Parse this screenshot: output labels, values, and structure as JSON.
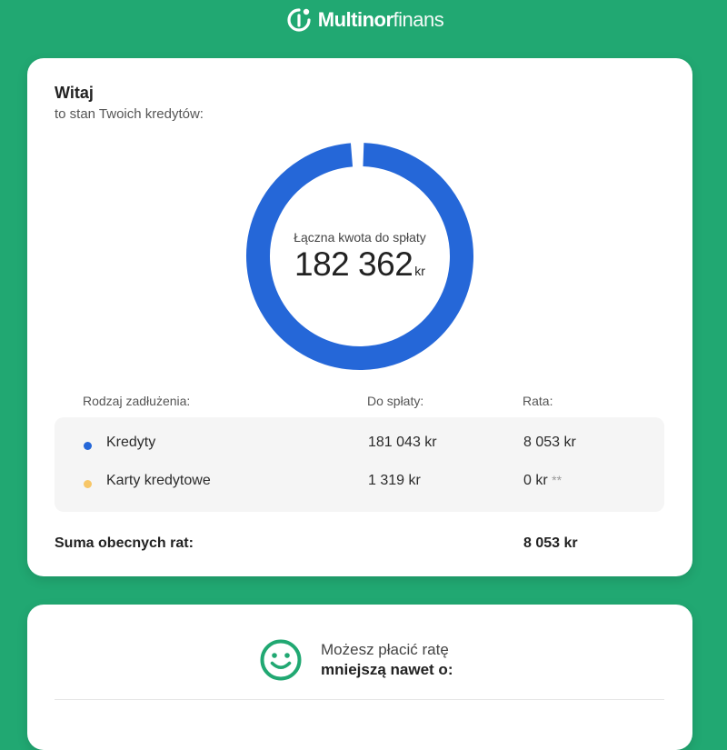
{
  "brand": {
    "name_bold": "Multinor",
    "name_light": "finans"
  },
  "summary": {
    "greeting": "Witaj",
    "subtitle": "to stan Twoich kredytów:",
    "total_label": "Łączna kwota do spłaty",
    "total_value": "182 362",
    "total_unit": "kr"
  },
  "table": {
    "headers": {
      "type": "Rodzaj zadłużenia:",
      "due": "Do spłaty:",
      "rate": "Rata:"
    },
    "rows": [
      {
        "name": "Kredyty",
        "due": "181 043 kr",
        "rate": "8 053 kr",
        "note": ""
      },
      {
        "name": "Karty kredytowe",
        "due": "1 319 kr",
        "rate": "0 kr",
        "note": "**"
      }
    ],
    "sum_label": "Suma obecnych rat:",
    "sum_value": "8 053 kr"
  },
  "payment": {
    "line1": "Możesz płacić ratę",
    "line2": "mniejszą nawet o:"
  },
  "chart_data": {
    "type": "pie",
    "categories": [
      "Kredyty",
      "Karty kredytowe"
    ],
    "values": [
      181043,
      1319
    ]
  },
  "colors": {
    "background": "#21a872",
    "credits": "#2567d8",
    "cards": "#f7c667",
    "smiley": "#21a872",
    "logo": "#ffffff"
  },
  "icons": {
    "logo": "multinor-logo-icon",
    "smiley": "smiley-icon",
    "credits_dot": "blue-dot-icon",
    "cards_dot": "yellow-dot-icon"
  }
}
